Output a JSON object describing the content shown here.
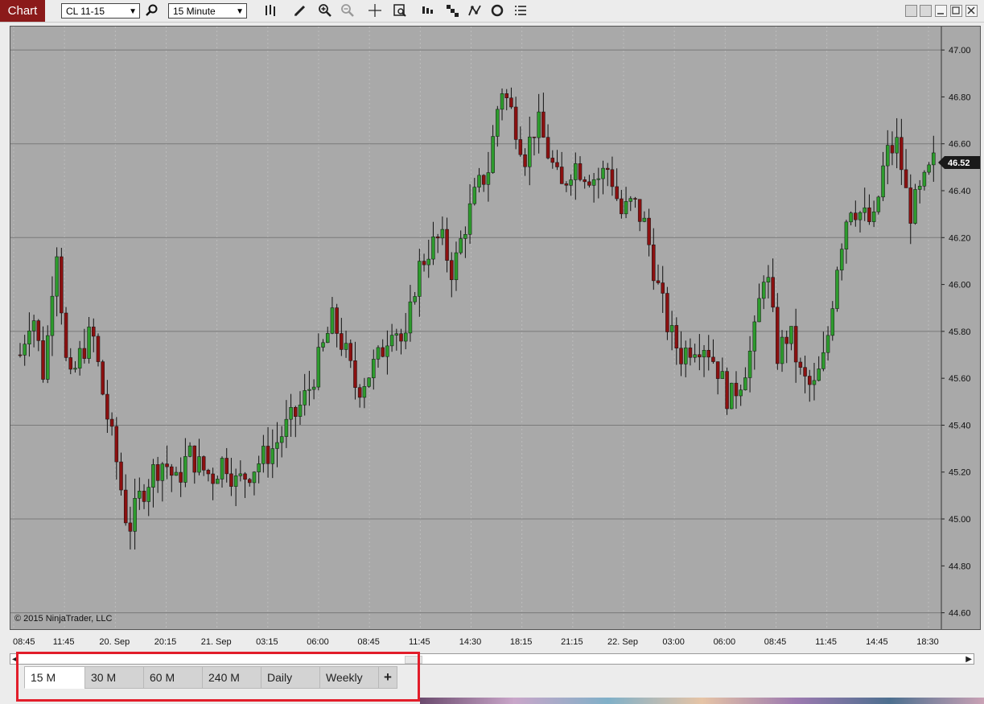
{
  "toolbar": {
    "app_title": "Chart",
    "instrument": "CL 11-15",
    "interval": "15 Minute",
    "icons": [
      "search-icon",
      "bar-type-icon",
      "pencil-icon",
      "zoom-in-icon",
      "zoom-out-icon",
      "crosshair-icon",
      "data-box-icon",
      "bar-style-icon",
      "indicator-icon",
      "strategy-icon",
      "reload-icon",
      "properties-icon"
    ]
  },
  "chart": {
    "copyright": "© 2015 NinjaTrader, LLC",
    "last_price": "46.52",
    "colors": {
      "background": "#a9a9a9",
      "up": "#2d9b2d",
      "down": "#8b1010",
      "grid": "#7a7a7a",
      "last_price_label": "#1a1a1a"
    },
    "y_ticks": [
      "47.00",
      "46.80",
      "46.60",
      "46.40",
      "46.20",
      "46.00",
      "45.80",
      "45.60",
      "45.40",
      "45.20",
      "45.00",
      "44.80",
      "44.60"
    ],
    "x_ticks": [
      "08:45",
      "11:45",
      "20. Sep",
      "20:15",
      "21. Sep",
      "03:15",
      "06:00",
      "08:45",
      "11:45",
      "14:30",
      "18:15",
      "21:15",
      "22. Sep",
      "03:00",
      "06:00",
      "08:45",
      "11:45",
      "14:45",
      "18:30"
    ]
  },
  "chart_data": {
    "type": "candlestick",
    "instrument": "CL 11-15",
    "interval": "15 Minute",
    "ylim": [
      44.53,
      47.1
    ],
    "price_path": [
      45.7,
      45.9,
      45.6,
      46.2,
      45.55,
      45.7,
      45.8,
      45.5,
      45.25,
      44.95,
      45.1,
      45.2,
      45.25,
      45.15,
      45.28,
      45.22,
      45.18,
      45.26,
      45.15,
      45.2,
      45.25,
      45.3,
      45.38,
      45.45,
      45.55,
      45.7,
      45.85,
      45.72,
      45.55,
      45.62,
      45.7,
      45.85,
      45.72,
      46.05,
      46.15,
      46.2,
      46.05,
      46.25,
      46.4,
      46.5,
      46.85,
      46.72,
      46.55,
      46.7,
      46.55,
      46.4,
      46.52,
      46.48,
      46.45,
      46.5,
      46.3,
      46.35,
      46.25,
      46.0,
      45.8,
      45.7,
      45.75,
      45.75,
      45.65,
      45.5,
      45.6,
      45.75,
      46.1,
      45.7,
      45.8,
      45.6,
      45.55,
      45.7,
      46.1,
      46.35,
      46.3,
      46.25,
      46.55,
      46.6,
      46.3,
      46.4,
      46.52
    ]
  },
  "tabs": [
    "15 M",
    "30 M",
    "60 M",
    "240 M",
    "Daily",
    "Weekly"
  ],
  "active_tab": "15 M",
  "add_tab_label": "+"
}
